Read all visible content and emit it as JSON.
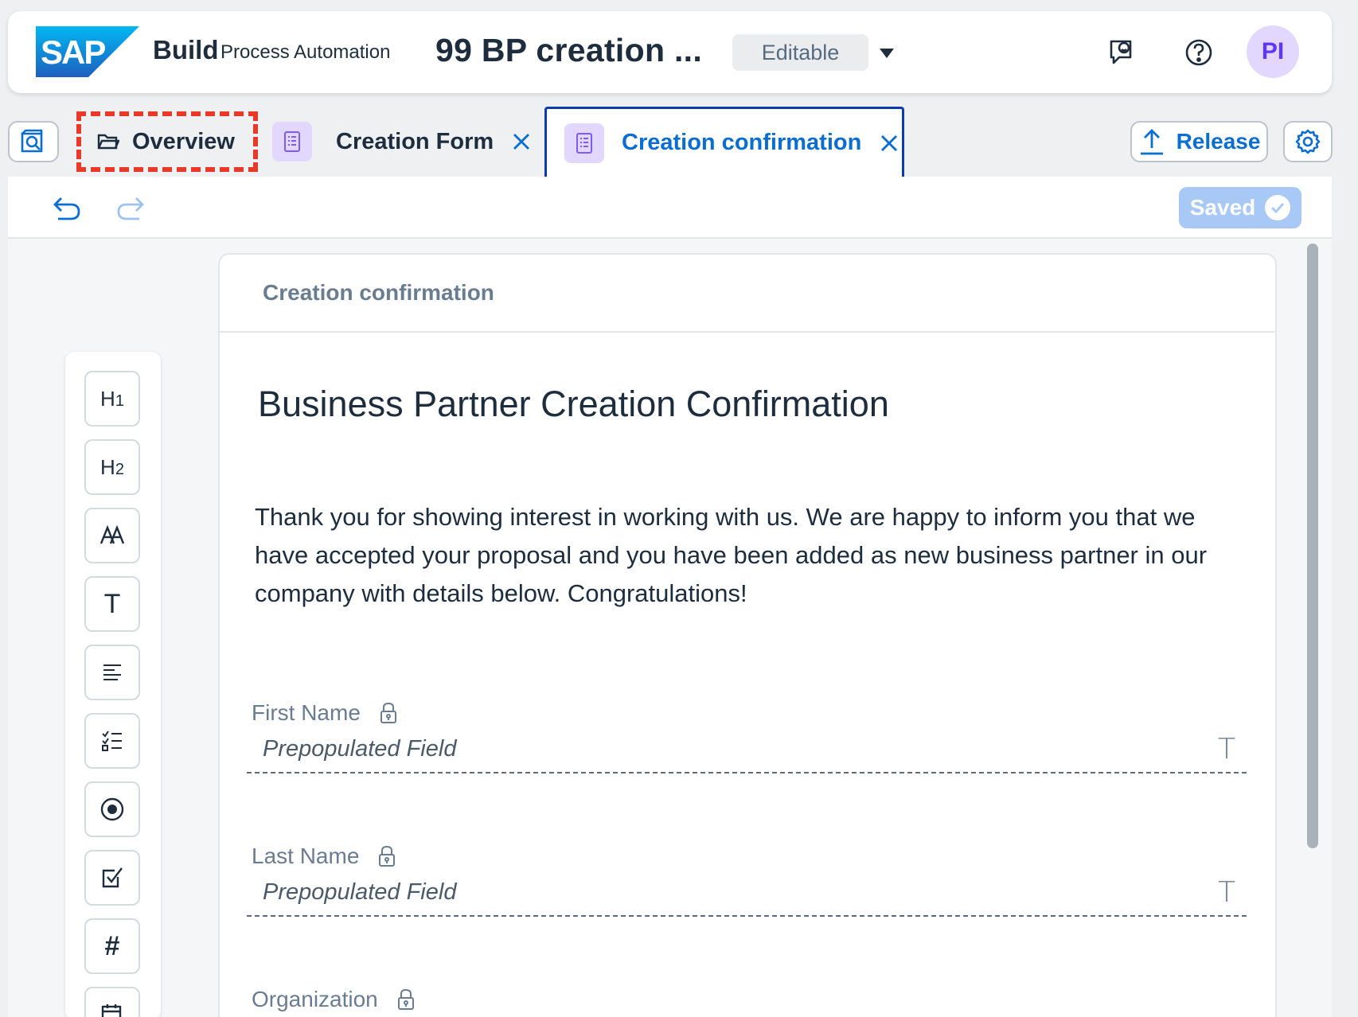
{
  "shell": {
    "logo_text": "SAP",
    "product": "Build",
    "product_sub": "Process Automation",
    "project_title": "99 BP creation ...",
    "status_badge": "Editable",
    "avatar_initials": "PI"
  },
  "tabs": {
    "overview_label": "Overview",
    "form_label": "Creation Form",
    "active_label": "Creation confirmation"
  },
  "actions": {
    "release_label": "Release",
    "saved_label": "Saved"
  },
  "form": {
    "card_title": "Creation confirmation",
    "heading": "Business Partner Creation Confirmation",
    "paragraph": "Thank you for showing interest in working with us. We are happy to inform you that we have accepted your proposal and you have been added as new business partner in our company with details below. Congratulations!",
    "fields": [
      {
        "label": "First Name",
        "placeholder": "Prepopulated Field",
        "type_icon": "T"
      },
      {
        "label": "Last Name",
        "placeholder": "Prepopulated Field",
        "type_icon": "T"
      },
      {
        "label": "Organization"
      }
    ]
  },
  "palette": {
    "h1": "H",
    "h1_sub": "1",
    "h2": "H",
    "h2_sub": "2",
    "text": "T",
    "number": "#"
  },
  "colors": {
    "accent": "#0a6ed1",
    "active_tab_border": "#0a3bb3",
    "highlight_dashed": "#e8392a",
    "avatar_bg": "#e2d8ff",
    "saved_bg": "#a8c8f6"
  },
  "icons": [
    "sap-logo",
    "feedback-icon",
    "help-icon",
    "search-document-icon",
    "folder-icon",
    "form-document-icon",
    "close-icon",
    "upload-icon",
    "gear-icon",
    "undo-icon",
    "redo-icon",
    "check-icon",
    "lock-icon"
  ]
}
